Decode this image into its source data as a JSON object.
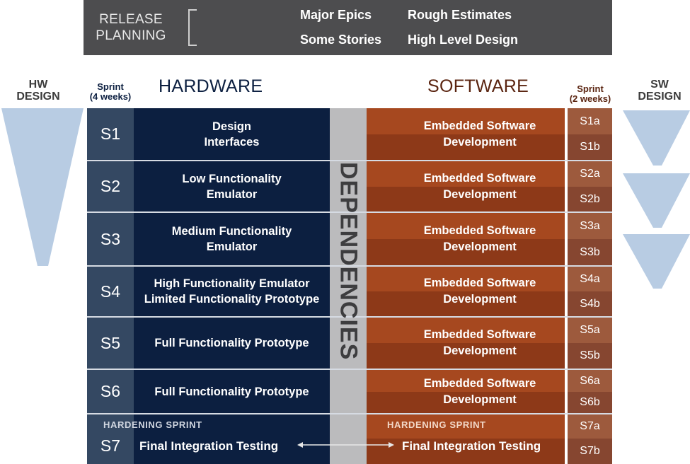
{
  "release_planning": {
    "title_line1": "RELEASE",
    "title_line2": "PLANNING",
    "items": [
      "Major Epics",
      "Rough Estimates",
      "Some Stories",
      "High Level Design"
    ]
  },
  "hw_design_label": [
    "HW",
    "DESIGN"
  ],
  "sw_design_label": [
    "SW",
    "DESIGN"
  ],
  "hw_sprint_header": [
    "Sprint",
    "(4 weeks)"
  ],
  "sw_sprint_header": [
    "Sprint",
    "(2 weeks)"
  ],
  "hardware_title": "HARDWARE",
  "software_title": "SOFTWARE",
  "dependencies_label": "DEPENDENCIES",
  "rows": [
    {
      "sprint": "S1",
      "hw_line1": "Design",
      "hw_line2": "Interfaces",
      "sw_line1": "Embedded Software",
      "sw_line2": "Development",
      "sw_a": "S1a",
      "sw_b": "S1b"
    },
    {
      "sprint": "S2",
      "hw_line1": "Low Functionality",
      "hw_line2": "Emulator",
      "sw_line1": "Embedded Software",
      "sw_line2": "Development",
      "sw_a": "S2a",
      "sw_b": "S2b"
    },
    {
      "sprint": "S3",
      "hw_line1": "Medium Functionality",
      "hw_line2": "Emulator",
      "sw_line1": "Embedded Software",
      "sw_line2": "Development",
      "sw_a": "S3a",
      "sw_b": "S3b"
    },
    {
      "sprint": "S4",
      "hw_line1": "High Functionality Emulator",
      "hw_line2": "Limited Functionality Prototype",
      "sw_line1": "Embedded Software",
      "sw_line2": "Development",
      "sw_a": "S4a",
      "sw_b": "S4b"
    },
    {
      "sprint": "S5",
      "hw_line1": "Full Functionality Prototype",
      "hw_line2": "",
      "sw_line1": "Embedded Software",
      "sw_line2": "Development",
      "sw_a": "S5a",
      "sw_b": "S5b"
    },
    {
      "sprint": "S6",
      "hw_line1": "Full Functionality Prototype",
      "hw_line2": "",
      "sw_line1": "Embedded Software",
      "sw_line2": "Development",
      "sw_a": "S6a",
      "sw_b": "S6b"
    }
  ],
  "hardening": {
    "sprint": "S7",
    "hw_label": "HARDENING SPRINT",
    "hw_task": "Final Integration Testing",
    "sw_label": "HARDENING SPRINT",
    "sw_task": "Final Integration Testing",
    "sw_a": "S7a",
    "sw_b": "S7b"
  },
  "colors": {
    "header_bg": "#4d4d4f",
    "hardware_dark": "#0c1f40",
    "hardware_sprint": "#344862",
    "software_light": "#a6481f",
    "software_dark": "#8d3918",
    "software_title": "#5a2410",
    "hardware_title": "#0c1f40",
    "dependencies": "#bbbbbd",
    "design_funnel": "#b8cce3"
  }
}
